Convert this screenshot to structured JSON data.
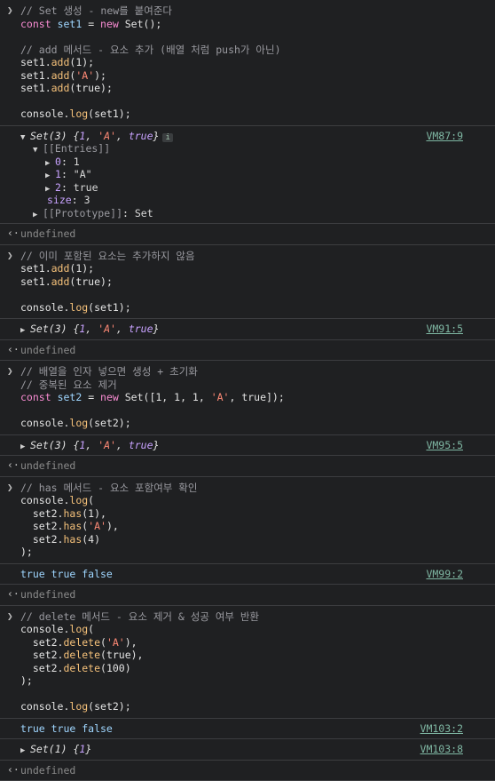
{
  "entries": [
    {
      "input": [
        "// Set 생성 - new를 붙여준다",
        "const set1 = new Set();",
        "",
        "// add 메서드 - 요소 추가 (배열 처럼 push가 아닌)",
        "set1.add(1);",
        "set1.add('A');",
        "set1.add(true);",
        "",
        "console.log(set1);"
      ],
      "log_source": "VM87:9",
      "log_header": "Set(3) {1, 'A', true}",
      "expanded": {
        "entries_label": "[[Entries]]",
        "items": [
          {
            "key": "0",
            "value": "1"
          },
          {
            "key": "1",
            "value": "\"A\""
          },
          {
            "key": "2",
            "value": "true"
          }
        ],
        "size_label": "size",
        "size_value": "3",
        "prototype_label": "[[Prototype]]",
        "prototype_value": "Set"
      },
      "return": "undefined"
    },
    {
      "input": [
        "// 이미 포함된 요소는 추가하지 않음",
        "set1.add(1);",
        "set1.add(true);",
        "",
        "console.log(set1);"
      ],
      "log_source": "VM91:5",
      "log_header": "Set(3) {1, 'A', true}",
      "return": "undefined"
    },
    {
      "input": [
        "// 배열을 인자 넣으면 생성 + 초기화",
        "// 중복된 요소 제거",
        "const set2 = new Set([1, 1, 1, 'A', true]);",
        "",
        "console.log(set2);"
      ],
      "log_source": "VM95:5",
      "log_header": "Set(3) {1, 'A', true}",
      "return": "undefined"
    },
    {
      "input": [
        "// has 메서드 - 요소 포함여부 확인",
        "console.log(",
        "  set2.has(1),",
        "  set2.has('A'),",
        "  set2.has(4)",
        ");"
      ],
      "log_source": "VM99:2",
      "log_text": "true true false",
      "return": "undefined"
    },
    {
      "input": [
        "// delete 메서드 - 요소 제거 & 성공 여부 반환",
        "console.log(",
        "  set2.delete('A'),",
        "  set2.delete(true),",
        "  set2.delete(100)",
        ");",
        "",
        "console.log(set2);"
      ],
      "log_source": "VM103:2",
      "log_text": "true true false",
      "log2_source": "VM103:8",
      "log2_header": "Set(1) {1}",
      "return": "undefined"
    }
  ],
  "colors": {
    "background": "#1f2022",
    "keyword": "#f78bd1",
    "function": "#f5c17a",
    "string": "#ff8a76",
    "number": "#c8a2ff",
    "link": "#7fb7a3"
  }
}
